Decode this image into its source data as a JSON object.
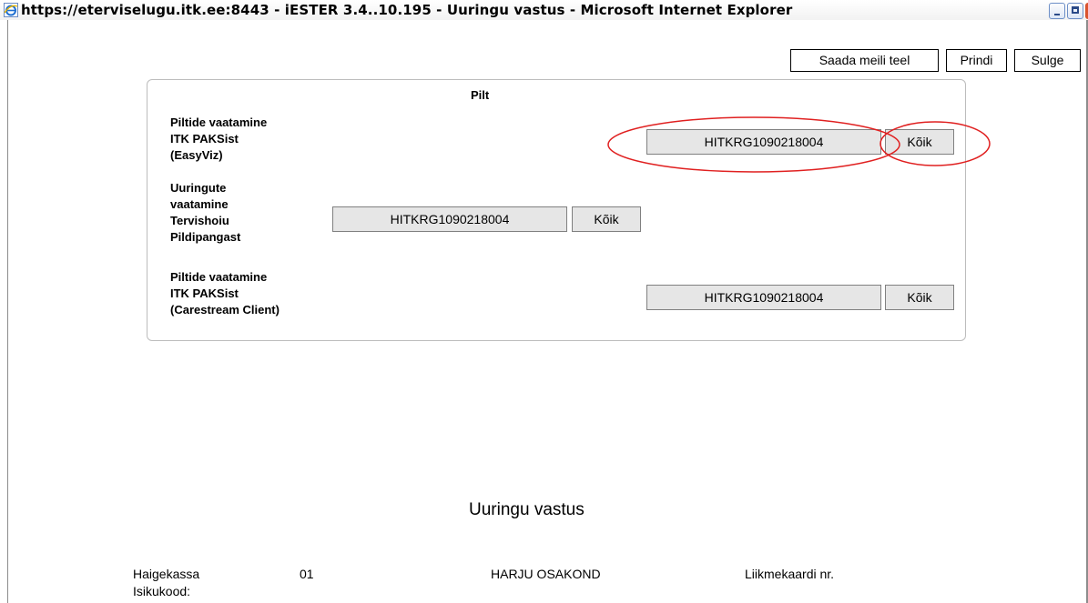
{
  "window": {
    "title": "https://eterviselugu.itk.ee:8443 - iESTER 3.4..10.195 - Uuringu vastus - Microsoft Internet Explorer"
  },
  "toolbar": {
    "email_label": "Saada meili teel",
    "print_label": "Prindi",
    "close_label": "Sulge"
  },
  "image_panel": {
    "title": "Pilt",
    "rows": [
      {
        "label_lines": [
          "Piltide vaatamine",
          "ITK PAKSist",
          "(EasyViz)"
        ],
        "study_id": "HITKRG1090218004",
        "all_label": "Kõik"
      },
      {
        "label_lines": [
          "Uuringute",
          "vaatamine",
          "Tervishoiu",
          "Pildipangast"
        ],
        "study_id": "HITKRG1090218004",
        "all_label": "Kõik"
      },
      {
        "label_lines": [
          "Piltide vaatamine",
          "ITK PAKSist",
          "(Carestream Client)"
        ],
        "study_id": "HITKRG1090218004",
        "all_label": "Kõik"
      }
    ]
  },
  "report": {
    "heading": "Uuringu vastus",
    "insurance_label": "Haigekassa",
    "insurance_code": "01",
    "insurance_office": "HARJU OSAKOND",
    "member_card_label": "Liikmekaardi nr.",
    "id_code_label": "Isikukood:"
  },
  "colors": {
    "annotation": "#e02020",
    "button_face": "#e6e6e6"
  }
}
